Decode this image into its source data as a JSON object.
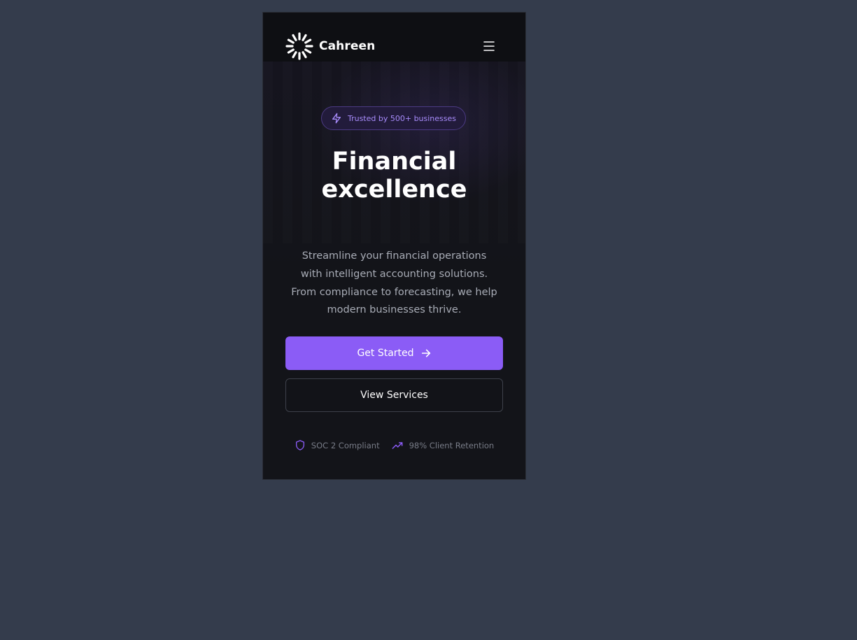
{
  "header": {
    "brand": "Cahreen",
    "logo_icon": "sunburst-logo-icon",
    "menu_icon": "hamburger-menu-icon"
  },
  "hero": {
    "badge": {
      "icon": "lightning-icon",
      "text": "Trusted by 500+ businesses"
    },
    "title_line1": "Financial",
    "title_line2": "excellence",
    "description": "Streamline your financial operations with intelligent accounting solutions. From compliance to forecasting, we help modern businesses thrive.",
    "primary_button": {
      "label": "Get Started",
      "icon": "arrow-right-icon"
    },
    "secondary_button": {
      "label": "View Services"
    },
    "trust_items": [
      {
        "icon": "shield-icon",
        "label": "SOC 2 Compliant"
      },
      {
        "icon": "trending-up-icon",
        "label": "98% Client Retention"
      }
    ]
  },
  "colors": {
    "accent": "#8b5cf6",
    "accent_text": "#a78bfa",
    "page_background": "#343c4c",
    "frame_background": "#131419"
  }
}
